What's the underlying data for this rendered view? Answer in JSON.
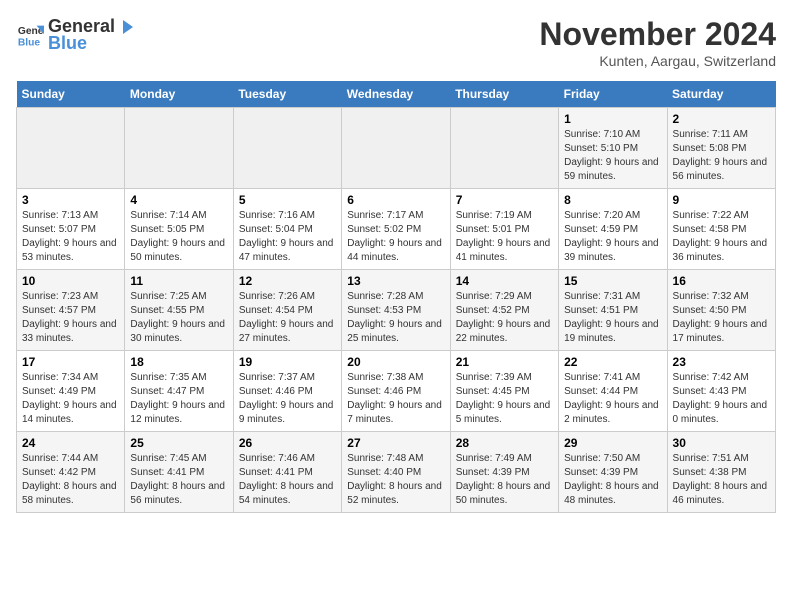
{
  "logo": {
    "text_general": "General",
    "text_blue": "Blue"
  },
  "title": "November 2024",
  "subtitle": "Kunten, Aargau, Switzerland",
  "days_of_week": [
    "Sunday",
    "Monday",
    "Tuesday",
    "Wednesday",
    "Thursday",
    "Friday",
    "Saturday"
  ],
  "weeks": [
    [
      {
        "day": "",
        "info": ""
      },
      {
        "day": "",
        "info": ""
      },
      {
        "day": "",
        "info": ""
      },
      {
        "day": "",
        "info": ""
      },
      {
        "day": "",
        "info": ""
      },
      {
        "day": "1",
        "info": "Sunrise: 7:10 AM\nSunset: 5:10 PM\nDaylight: 9 hours and 59 minutes."
      },
      {
        "day": "2",
        "info": "Sunrise: 7:11 AM\nSunset: 5:08 PM\nDaylight: 9 hours and 56 minutes."
      }
    ],
    [
      {
        "day": "3",
        "info": "Sunrise: 7:13 AM\nSunset: 5:07 PM\nDaylight: 9 hours and 53 minutes."
      },
      {
        "day": "4",
        "info": "Sunrise: 7:14 AM\nSunset: 5:05 PM\nDaylight: 9 hours and 50 minutes."
      },
      {
        "day": "5",
        "info": "Sunrise: 7:16 AM\nSunset: 5:04 PM\nDaylight: 9 hours and 47 minutes."
      },
      {
        "day": "6",
        "info": "Sunrise: 7:17 AM\nSunset: 5:02 PM\nDaylight: 9 hours and 44 minutes."
      },
      {
        "day": "7",
        "info": "Sunrise: 7:19 AM\nSunset: 5:01 PM\nDaylight: 9 hours and 41 minutes."
      },
      {
        "day": "8",
        "info": "Sunrise: 7:20 AM\nSunset: 4:59 PM\nDaylight: 9 hours and 39 minutes."
      },
      {
        "day": "9",
        "info": "Sunrise: 7:22 AM\nSunset: 4:58 PM\nDaylight: 9 hours and 36 minutes."
      }
    ],
    [
      {
        "day": "10",
        "info": "Sunrise: 7:23 AM\nSunset: 4:57 PM\nDaylight: 9 hours and 33 minutes."
      },
      {
        "day": "11",
        "info": "Sunrise: 7:25 AM\nSunset: 4:55 PM\nDaylight: 9 hours and 30 minutes."
      },
      {
        "day": "12",
        "info": "Sunrise: 7:26 AM\nSunset: 4:54 PM\nDaylight: 9 hours and 27 minutes."
      },
      {
        "day": "13",
        "info": "Sunrise: 7:28 AM\nSunset: 4:53 PM\nDaylight: 9 hours and 25 minutes."
      },
      {
        "day": "14",
        "info": "Sunrise: 7:29 AM\nSunset: 4:52 PM\nDaylight: 9 hours and 22 minutes."
      },
      {
        "day": "15",
        "info": "Sunrise: 7:31 AM\nSunset: 4:51 PM\nDaylight: 9 hours and 19 minutes."
      },
      {
        "day": "16",
        "info": "Sunrise: 7:32 AM\nSunset: 4:50 PM\nDaylight: 9 hours and 17 minutes."
      }
    ],
    [
      {
        "day": "17",
        "info": "Sunrise: 7:34 AM\nSunset: 4:49 PM\nDaylight: 9 hours and 14 minutes."
      },
      {
        "day": "18",
        "info": "Sunrise: 7:35 AM\nSunset: 4:47 PM\nDaylight: 9 hours and 12 minutes."
      },
      {
        "day": "19",
        "info": "Sunrise: 7:37 AM\nSunset: 4:46 PM\nDaylight: 9 hours and 9 minutes."
      },
      {
        "day": "20",
        "info": "Sunrise: 7:38 AM\nSunset: 4:46 PM\nDaylight: 9 hours and 7 minutes."
      },
      {
        "day": "21",
        "info": "Sunrise: 7:39 AM\nSunset: 4:45 PM\nDaylight: 9 hours and 5 minutes."
      },
      {
        "day": "22",
        "info": "Sunrise: 7:41 AM\nSunset: 4:44 PM\nDaylight: 9 hours and 2 minutes."
      },
      {
        "day": "23",
        "info": "Sunrise: 7:42 AM\nSunset: 4:43 PM\nDaylight: 9 hours and 0 minutes."
      }
    ],
    [
      {
        "day": "24",
        "info": "Sunrise: 7:44 AM\nSunset: 4:42 PM\nDaylight: 8 hours and 58 minutes."
      },
      {
        "day": "25",
        "info": "Sunrise: 7:45 AM\nSunset: 4:41 PM\nDaylight: 8 hours and 56 minutes."
      },
      {
        "day": "26",
        "info": "Sunrise: 7:46 AM\nSunset: 4:41 PM\nDaylight: 8 hours and 54 minutes."
      },
      {
        "day": "27",
        "info": "Sunrise: 7:48 AM\nSunset: 4:40 PM\nDaylight: 8 hours and 52 minutes."
      },
      {
        "day": "28",
        "info": "Sunrise: 7:49 AM\nSunset: 4:39 PM\nDaylight: 8 hours and 50 minutes."
      },
      {
        "day": "29",
        "info": "Sunrise: 7:50 AM\nSunset: 4:39 PM\nDaylight: 8 hours and 48 minutes."
      },
      {
        "day": "30",
        "info": "Sunrise: 7:51 AM\nSunset: 4:38 PM\nDaylight: 8 hours and 46 minutes."
      }
    ]
  ]
}
